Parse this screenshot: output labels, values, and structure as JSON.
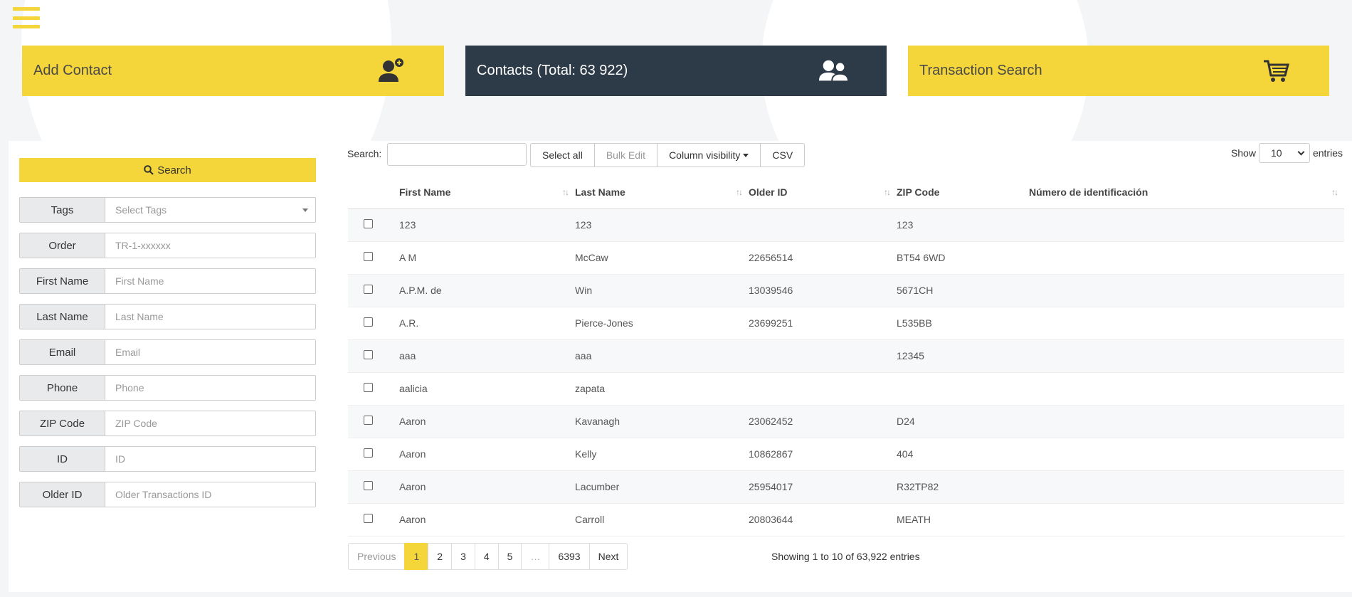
{
  "nav": {
    "menu_icon": "hamburger-icon"
  },
  "tiles": [
    {
      "label": "Add Contact",
      "icon": "add-user-icon",
      "color": "#f4d53a"
    },
    {
      "label": "Contacts (Total: 63 922)",
      "icon": "users-icon",
      "color": "#2d3a48"
    },
    {
      "label": "Transaction Search",
      "icon": "cart-icon",
      "color": "#f4d53a"
    }
  ],
  "filters": {
    "search_button": "Search",
    "tags": {
      "label": "Tags",
      "placeholder": "Select Tags"
    },
    "order": {
      "label": "Order",
      "placeholder": "TR-1-xxxxxx"
    },
    "first_name": {
      "label": "First Name",
      "placeholder": "First Name"
    },
    "last_name": {
      "label": "Last Name",
      "placeholder": "Last Name"
    },
    "email": {
      "label": "Email",
      "placeholder": "Email"
    },
    "phone": {
      "label": "Phone",
      "placeholder": "Phone"
    },
    "zip": {
      "label": "ZIP Code",
      "placeholder": "ZIP Code"
    },
    "id": {
      "label": "ID",
      "placeholder": "ID"
    },
    "older_id": {
      "label": "Older ID",
      "placeholder": "Older Transactions ID"
    }
  },
  "toolbar": {
    "search_label": "Search:",
    "search_value": "",
    "select_all": "Select all",
    "bulk_edit": "Bulk Edit",
    "column_visibility": "Column visibility",
    "csv": "CSV",
    "show_label": "Show",
    "show_value": "10",
    "entries_label": "entries"
  },
  "table": {
    "headers": [
      "First Name",
      "Last Name",
      "Older ID",
      "ZIP Code",
      "Número de identificación"
    ],
    "rows": [
      [
        "123",
        "123",
        "",
        "123",
        ""
      ],
      [
        "A M",
        "McCaw",
        "22656514",
        "BT54 6WD",
        ""
      ],
      [
        "A.P.M. de",
        "Win",
        "13039546",
        "5671CH",
        ""
      ],
      [
        "A.R.",
        "Pierce-Jones",
        "23699251",
        "L535BB",
        ""
      ],
      [
        "aaa",
        "aaa",
        "",
        "12345",
        ""
      ],
      [
        "aalicia",
        "zapata",
        "",
        "",
        ""
      ],
      [
        "Aaron",
        "Kavanagh",
        "23062452",
        "D24",
        ""
      ],
      [
        "Aaron",
        "Kelly",
        "10862867",
        "404",
        ""
      ],
      [
        "Aaron",
        "Lacumber",
        "25954017",
        "R32TP82",
        ""
      ],
      [
        "Aaron",
        "Carroll",
        "20803644",
        "MEATH",
        ""
      ]
    ]
  },
  "pagination": {
    "previous": "Previous",
    "pages": [
      "1",
      "2",
      "3",
      "4",
      "5",
      "…",
      "6393"
    ],
    "active": "1",
    "next": "Next",
    "info": "Showing 1 to 10 of 63,922 entries"
  }
}
